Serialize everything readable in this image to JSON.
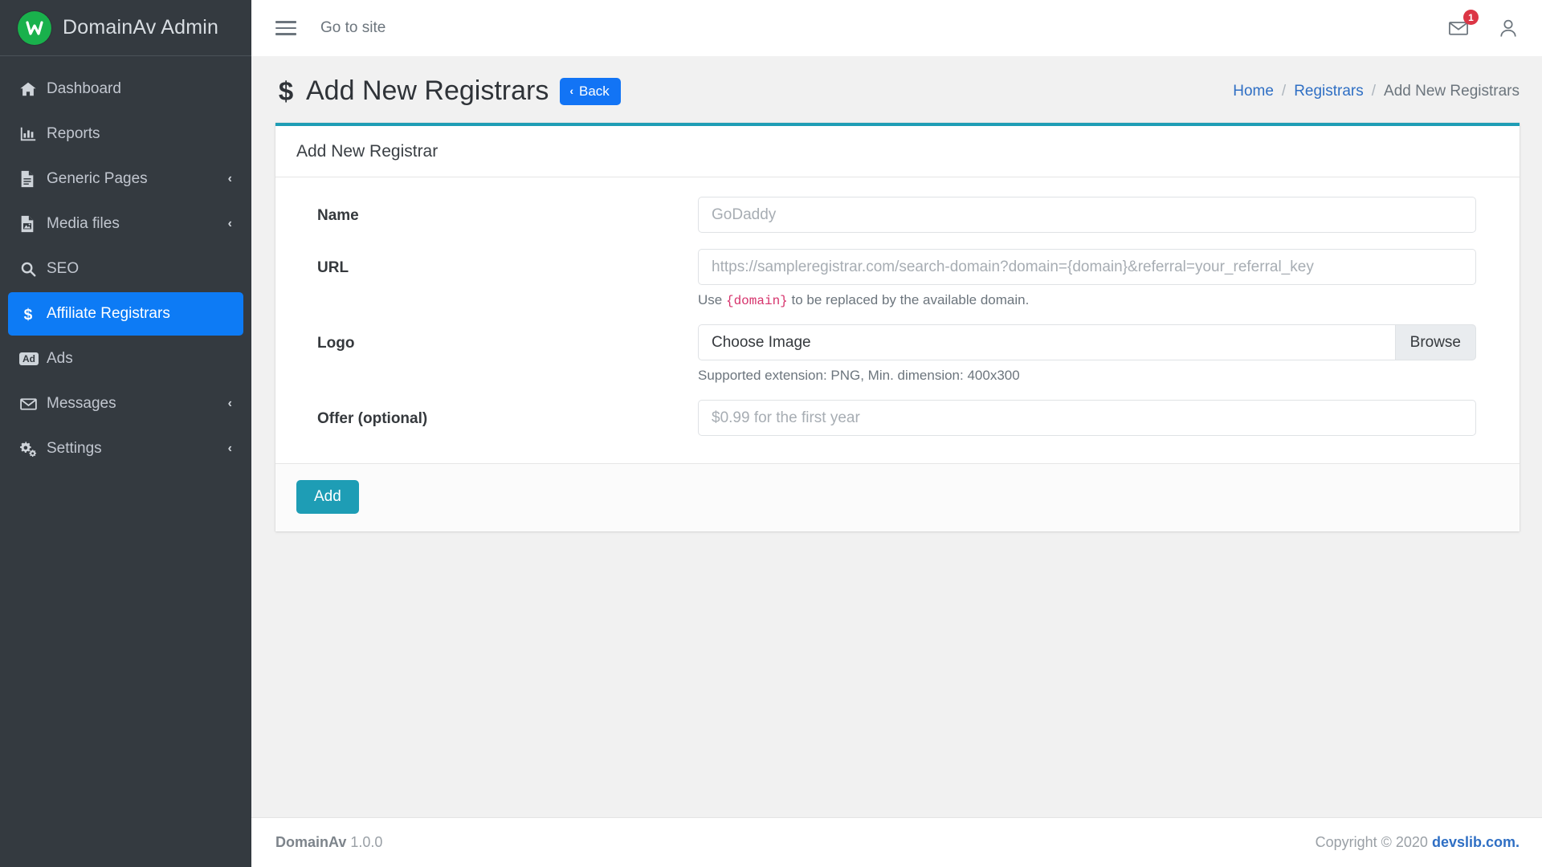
{
  "sidebar": {
    "brand": {
      "title": "DomainAv Admin",
      "logo_letter": "W",
      "logo_color": "#19b14c"
    },
    "items": [
      {
        "label": "Dashboard",
        "icon": "home-icon",
        "caret": "",
        "active": false
      },
      {
        "label": "Reports",
        "icon": "chart-bar-icon",
        "caret": "",
        "active": false
      },
      {
        "label": "Generic Pages",
        "icon": "file-icon",
        "caret": "‹",
        "active": false
      },
      {
        "label": "Media files",
        "icon": "image-file-icon",
        "caret": "‹",
        "active": false
      },
      {
        "label": "SEO",
        "icon": "search-icon",
        "caret": "",
        "active": false
      },
      {
        "label": "Affiliate Registrars",
        "icon": "dollar-icon",
        "caret": "",
        "active": true
      },
      {
        "label": "Ads",
        "icon": "ad-icon",
        "caret": "",
        "active": false
      },
      {
        "label": "Messages",
        "icon": "envelope-icon",
        "caret": "‹",
        "active": false
      },
      {
        "label": "Settings",
        "icon": "cogs-icon",
        "caret": "‹",
        "active": false
      }
    ],
    "ad_badge_text": "Ad",
    "active_color": "#0d7bf5"
  },
  "topbar": {
    "menu_toggle": "hamburger-icon",
    "goto_site_label": "Go to site",
    "messages_badge": "1",
    "badge_color": "#dc3545"
  },
  "page": {
    "title": "Add New Registrars",
    "title_icon": "dollar-icon",
    "back_label": "Back",
    "back_chevron": "‹",
    "back_color": "#1274f5",
    "breadcrumb": [
      {
        "label": "Home",
        "link": true
      },
      {
        "label": "Registrars",
        "link": true
      },
      {
        "label": "Add New Registrars",
        "link": false
      }
    ],
    "breadcrumb_separator": "/"
  },
  "card": {
    "accent_color": "#1e9db5",
    "header": "Add New Registrar",
    "fields": [
      {
        "label": "Name",
        "type": "text",
        "value": "",
        "placeholder": "GoDaddy",
        "help": ""
      },
      {
        "label": "URL",
        "type": "text",
        "value": "",
        "placeholder": "https://sampleregistrar.com/search-domain?domain={domain}&referral=your_referral_key",
        "help_prefix": "Use ",
        "help_code": "{domain}",
        "help_suffix": " to be replaced by the available domain."
      },
      {
        "label": "Logo",
        "type": "file",
        "file_text": "Choose Image",
        "browse_label": "Browse",
        "help": "Supported extension: PNG, Min. dimension: 400x300"
      },
      {
        "label": "Offer (optional)",
        "type": "text",
        "value": "",
        "placeholder": "$0.99 for the first year",
        "help": ""
      }
    ],
    "submit_label": "Add",
    "submit_color": "#1e9db5"
  },
  "footer": {
    "app_name": "DomainAv",
    "version": "1.0.0",
    "copyright": "Copyright © 2020 ",
    "link_label": "devslib.com."
  }
}
